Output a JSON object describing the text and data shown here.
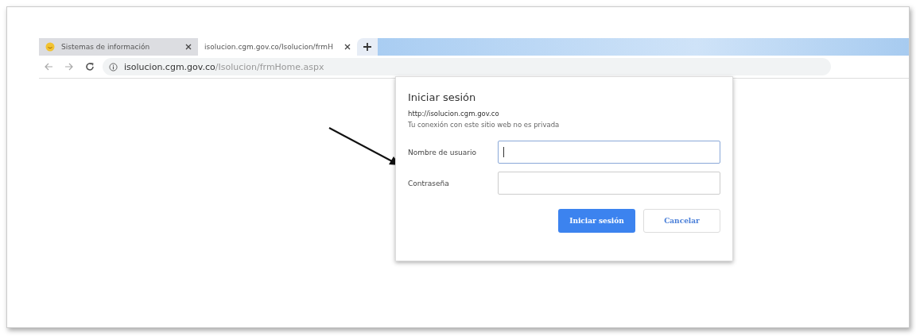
{
  "tabs": [
    {
      "label": "Sistemas de información",
      "selected": false,
      "favicon": true
    },
    {
      "label": "isolucion.cgm.gov.co/Isolucion/frmH",
      "selected": true,
      "favicon": false
    }
  ],
  "address_bar": {
    "host": "isolucion.cgm.gov.co",
    "path": "/Isolucion/frmHome.aspx"
  },
  "dialog": {
    "title": "Iniciar sesión",
    "origin": "http://isolucion.cgm.gov.co",
    "warning": "Tu conexión con este sitio web no es privada",
    "fields": [
      {
        "label": "Nombre de usuario",
        "focused": true
      },
      {
        "label": "Contraseña",
        "focused": false
      }
    ],
    "buttons": [
      {
        "label": "Iniciar sesión",
        "kind": "primary"
      },
      {
        "label": "Cancelar",
        "kind": "secondary"
      }
    ]
  }
}
